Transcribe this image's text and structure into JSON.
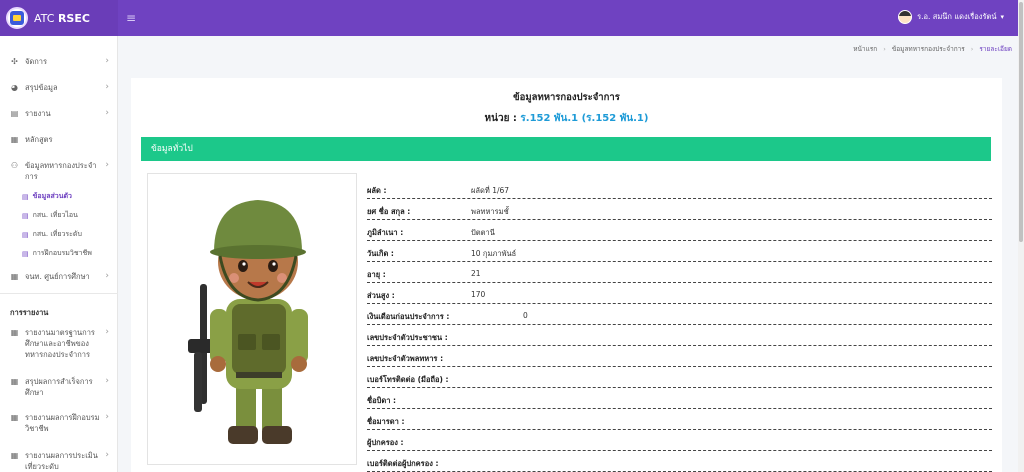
{
  "brand": {
    "prefix": "ATC",
    "name": "RSEC"
  },
  "header": {
    "menu_glyph": "≡",
    "user_name": "ร.อ. สมนึก แดงเรื่องรัตน์",
    "caret": "▾"
  },
  "sidebar": {
    "items": [
      {
        "label": "จัดการ",
        "icon": "✣"
      },
      {
        "label": "สรุปข้อมูล",
        "icon": "◕"
      },
      {
        "label": "รายงาน",
        "icon": "▤"
      },
      {
        "label": "หลักสูตร",
        "icon": "▦"
      },
      {
        "label": "ข้อมูลทหารกองประจำการ",
        "icon": "⚇"
      }
    ],
    "subitems": [
      {
        "label": "ข้อมูลส่วนตัว",
        "active": true
      },
      {
        "label": "กสน. เที่ยวไอน"
      },
      {
        "label": "กสน. เที่ยวระดับ"
      },
      {
        "label": "การฝึกอบรมวิชาชีพ"
      }
    ],
    "item_after": {
      "label": "จนท. ศูนย์การศึกษา",
      "icon": "▦"
    },
    "report_section": "การรายงาน",
    "report_items": [
      {
        "label": "รายงานมาตรฐานการศึกษาและอาชีพของทหารกองประจำการ",
        "icon": "▦"
      },
      {
        "label": "สรุปผลการสำเร็จการศึกษา",
        "icon": "▦"
      },
      {
        "label": "รายงานผลการฝึกอบรมวิชาชีพ",
        "icon": "▦"
      },
      {
        "label": "รายงานผลการประเมินเที่ยวระดับ",
        "icon": "▦"
      }
    ],
    "chevron": "›",
    "sub_icon": "▤"
  },
  "breadcrumb": {
    "home": "หน้าแรก",
    "section": "ข้อมูลทหารกองประจำการ",
    "current": "รายละเอียด",
    "sep": "›"
  },
  "page": {
    "title": "ข้อมูลทหารกองประจำการ",
    "unit_label": "หน่วย :",
    "unit_value": "ร.152 พัน.1 (ร.152 พัน.1)",
    "section_title": "ข้อมูลทั่วไป"
  },
  "info_rows": [
    {
      "label": "ผลัด :",
      "value": "ผลัดที่ 1/67"
    },
    {
      "label": "ยศ ชื่อ สกุล :",
      "value": "พลทหารมชั้"
    },
    {
      "label": "ภูมิลำเนา :",
      "value": "ปัตตานี"
    },
    {
      "label": "วันเกิด :",
      "value": "10 กุมภาพันธ์"
    },
    {
      "label": "อายุ :",
      "value": "21"
    },
    {
      "label": "ส่วนสูง :",
      "value": "170"
    },
    {
      "label": "เงินเดือนก่อนประจำการ :",
      "value": "0",
      "far": true
    },
    {
      "label": "เลขประจำตัวประชาชน :",
      "value": ""
    },
    {
      "label": "เลขประจำตัวพลทหาร :",
      "value": ""
    },
    {
      "label": "เบอร์โทรติดต่อ (มือถือ) :",
      "value": ""
    },
    {
      "label": "ชื่อบิดา :",
      "value": ""
    },
    {
      "label": "ชื่อมารดา :",
      "value": ""
    },
    {
      "label": "ผู้ปกครอง :",
      "value": ""
    },
    {
      "label": "เบอร์ติดต่อผู้ปกครอง :",
      "value": ""
    }
  ],
  "colors": {
    "header": "#6f42c1",
    "green": "#1cc88a",
    "unit": "#1e9bd7"
  }
}
